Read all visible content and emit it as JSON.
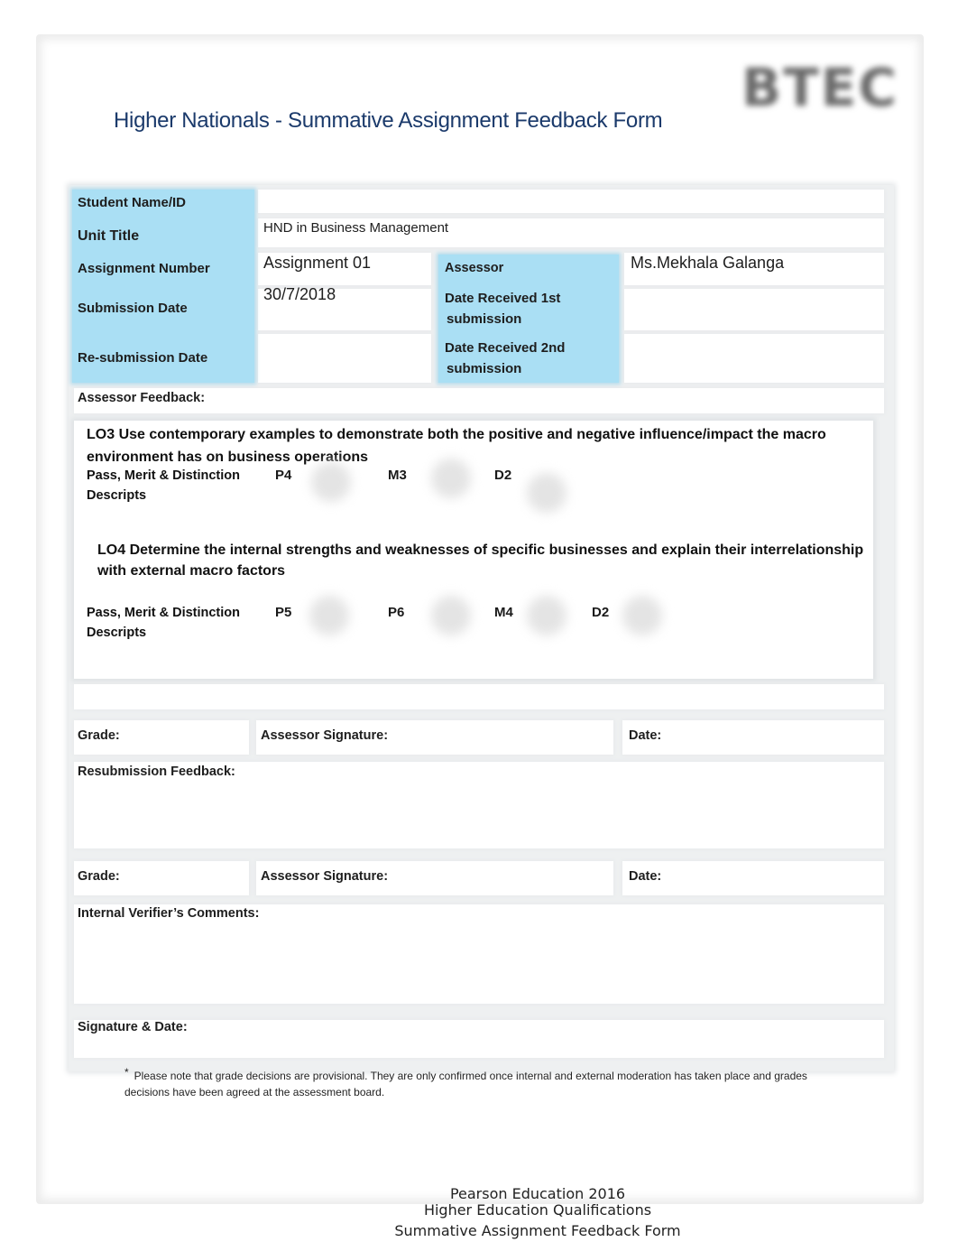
{
  "header": {
    "logo_text": "BTEC",
    "title": "Higher Nationals - Summative Assignment Feedback Form"
  },
  "info": {
    "student_name_label": "Student Name/ID",
    "student_name_value": "",
    "unit_title_label": "Unit Title",
    "unit_title_value": "HND in Business Management",
    "assignment_number_label": "Assignment  Number",
    "assignment_number_value": "Assignment 01",
    "assessor_label": "Assessor",
    "assessor_value": "Ms.Mekhala Galanga",
    "submission_date_label": "Submission Date",
    "submission_date_value": "30/7/2018",
    "date_received_1_label_line1": "Date Received 1st",
    "date_received_1_label_line2": "submission",
    "date_received_1_value": "",
    "resubmission_date_label": "Re-submission Date",
    "resubmission_date_value": "",
    "date_received_2_label_line1": "Date Received 2nd",
    "date_received_2_label_line2": "submission",
    "date_received_2_value": ""
  },
  "feedback": {
    "label": "Assessor  Feedback:",
    "lo3": {
      "text": "LO3 Use contemporary examples to demonstrate both the positive and negative influence/impact the macro environment has on business operations",
      "pmd_label_line1": "Pass, Merit & Distinction",
      "pmd_label_line2": "Descripts",
      "criteria": [
        "P4",
        "M3",
        "D2"
      ]
    },
    "lo4": {
      "text": "LO4 Determine the internal strengths and weaknesses of specific businesses and explain their interrelationship with external macro factors",
      "pmd_label_line1": "Pass, Merit & Distinction",
      "pmd_label_line2": "Descripts",
      "criteria": [
        "P5",
        "P6",
        "M4",
        "D2"
      ]
    }
  },
  "grading_1": {
    "grade_label": "Grade:",
    "signature_label": "Assessor Signature:",
    "date_label": "Date:"
  },
  "resubmission_feedback_label": "Resubmission Feedback:",
  "grading_2": {
    "grade_label": "Grade:",
    "signature_label": "Assessor Signature:",
    "date_label": "Date:"
  },
  "internal_verifier_label": "Internal Verifier’s Comments:",
  "signature_date_label": "Signature & Date:",
  "note": {
    "marker": "*",
    "text": "Please note that grade decisions are provisional. They are only confirmed once internal and external moderation has taken place and grades decisions have been agreed at the assessment board."
  },
  "footer": {
    "line1": "Pearson Education 2016",
    "line2": "Higher Education Qualifications",
    "line3": "Summative Assignment Feedback Form"
  }
}
